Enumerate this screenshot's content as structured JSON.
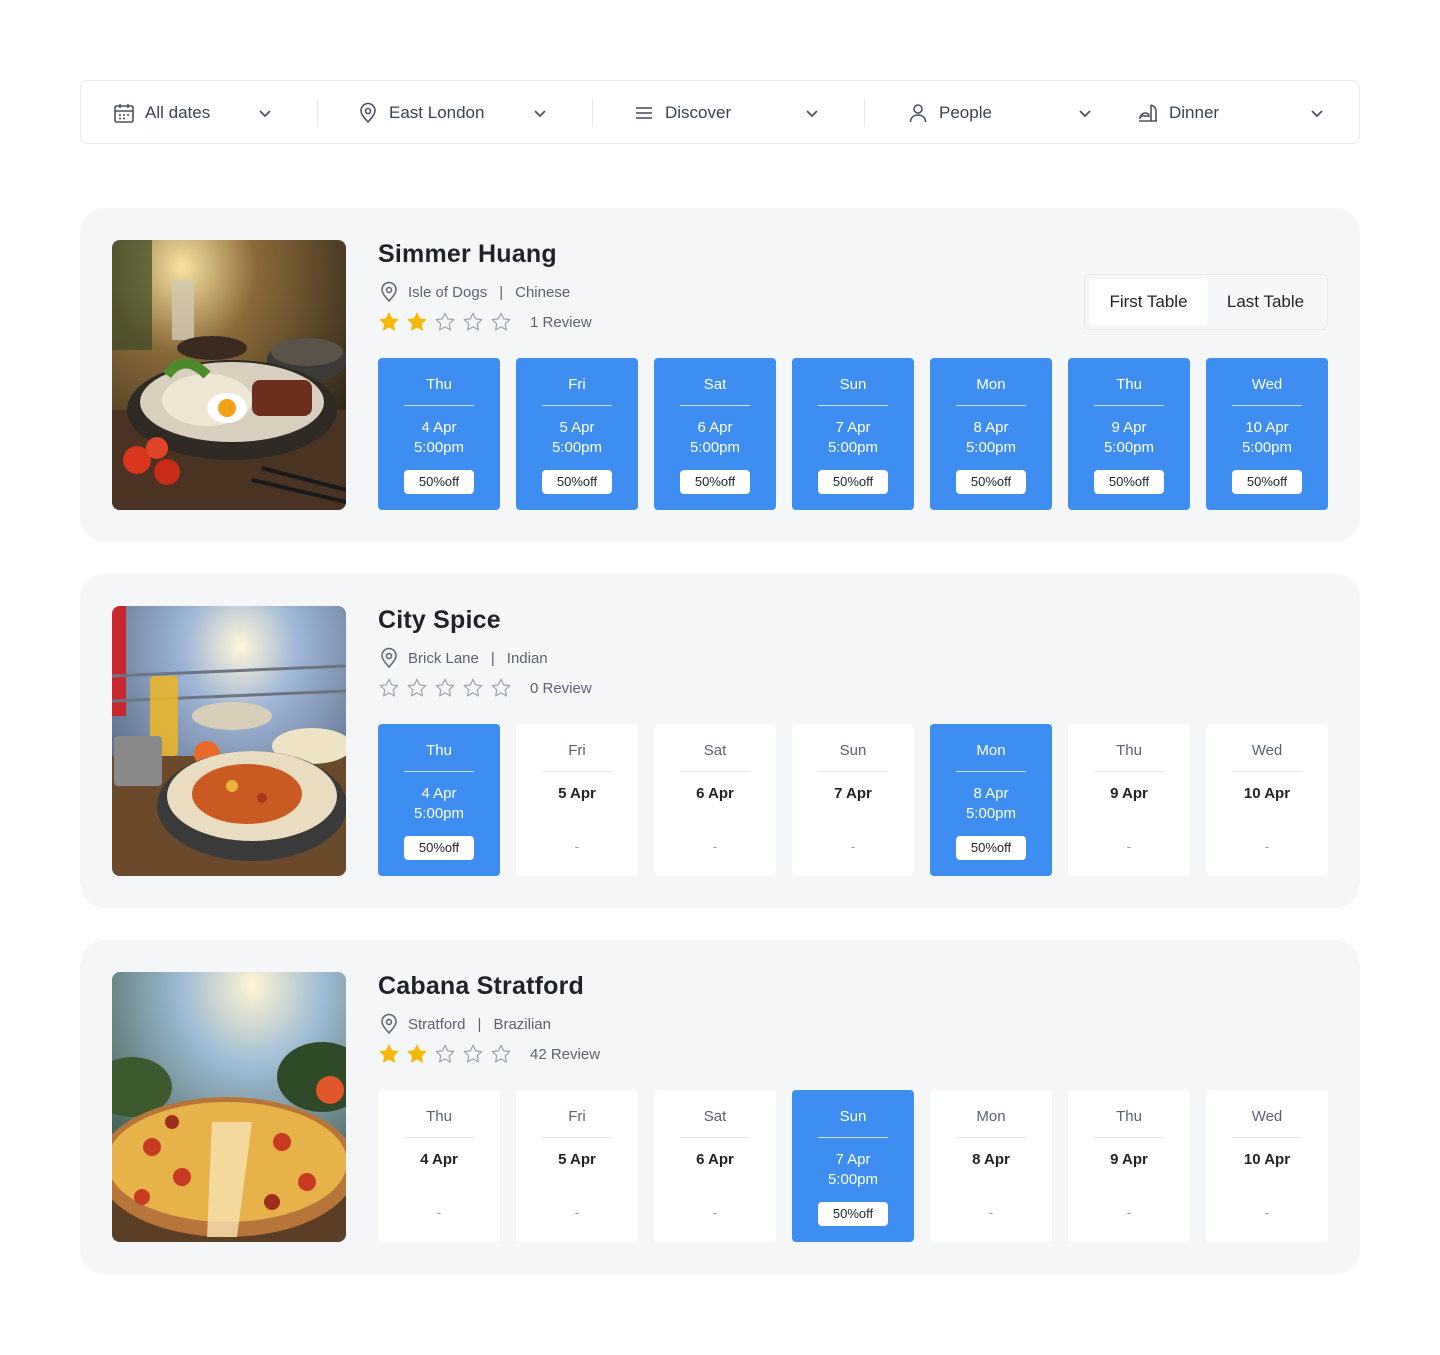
{
  "filters": {
    "date": "All dates",
    "location": "East London",
    "discover": "Discover",
    "people": "People",
    "meal": "Dinner"
  },
  "accent_color": "#3d8ef0",
  "star_color": "#f6b80b",
  "restaurants": [
    {
      "name": "Simmer Huang",
      "area": "Isle of Dogs",
      "cuisine": "Chinese",
      "rating": 2,
      "reviews": "1 Review",
      "toggle": {
        "first": "First Table",
        "last": "Last Table"
      },
      "slots": [
        {
          "day": "Thu",
          "date": "4 Apr",
          "time": "5:00pm",
          "offer": "50%off",
          "available": true
        },
        {
          "day": "Fri",
          "date": "5 Apr",
          "time": "5:00pm",
          "offer": "50%off",
          "available": true
        },
        {
          "day": "Sat",
          "date": "6 Apr",
          "time": "5:00pm",
          "offer": "50%off",
          "available": true
        },
        {
          "day": "Sun",
          "date": "7 Apr",
          "time": "5:00pm",
          "offer": "50%off",
          "available": true
        },
        {
          "day": "Mon",
          "date": "8 Apr",
          "time": "5:00pm",
          "offer": "50%off",
          "available": true
        },
        {
          "day": "Thu",
          "date": "9 Apr",
          "time": "5:00pm",
          "offer": "50%off",
          "available": true
        },
        {
          "day": "Wed",
          "date": "10 Apr",
          "time": "5:00pm",
          "offer": "50%off",
          "available": true
        }
      ]
    },
    {
      "name": "City Spice",
      "area": "Brick Lane",
      "cuisine": "Indian",
      "rating": 0,
      "reviews": "0 Review",
      "slots": [
        {
          "day": "Thu",
          "date": "4 Apr",
          "time": "5:00pm",
          "offer": "50%off",
          "available": true
        },
        {
          "day": "Fri",
          "date": "5 Apr",
          "placeholder": "-",
          "available": false
        },
        {
          "day": "Sat",
          "date": "6 Apr",
          "placeholder": "-",
          "available": false
        },
        {
          "day": "Sun",
          "date": "7 Apr",
          "placeholder": "-",
          "available": false
        },
        {
          "day": "Mon",
          "date": "8 Apr",
          "time": "5:00pm",
          "offer": "50%off",
          "available": true
        },
        {
          "day": "Thu",
          "date": "9 Apr",
          "placeholder": "-",
          "available": false
        },
        {
          "day": "Wed",
          "date": "10 Apr",
          "placeholder": "-",
          "available": false
        }
      ]
    },
    {
      "name": "Cabana Stratford",
      "area": "Stratford",
      "cuisine": "Brazilian",
      "rating": 2,
      "reviews": "42 Review",
      "slots": [
        {
          "day": "Thu",
          "date": "4 Apr",
          "placeholder": "-",
          "available": false
        },
        {
          "day": "Fri",
          "date": "5 Apr",
          "placeholder": "-",
          "available": false
        },
        {
          "day": "Sat",
          "date": "6 Apr",
          "placeholder": "-",
          "available": false
        },
        {
          "day": "Sun",
          "date": "7 Apr",
          "time": "5:00pm",
          "offer": "50%off",
          "available": true
        },
        {
          "day": "Mon",
          "date": "8 Apr",
          "placeholder": "-",
          "available": false
        },
        {
          "day": "Thu",
          "date": "9 Apr",
          "placeholder": "-",
          "available": false
        },
        {
          "day": "Wed",
          "date": "10 Apr",
          "placeholder": "-",
          "available": false
        }
      ]
    }
  ]
}
